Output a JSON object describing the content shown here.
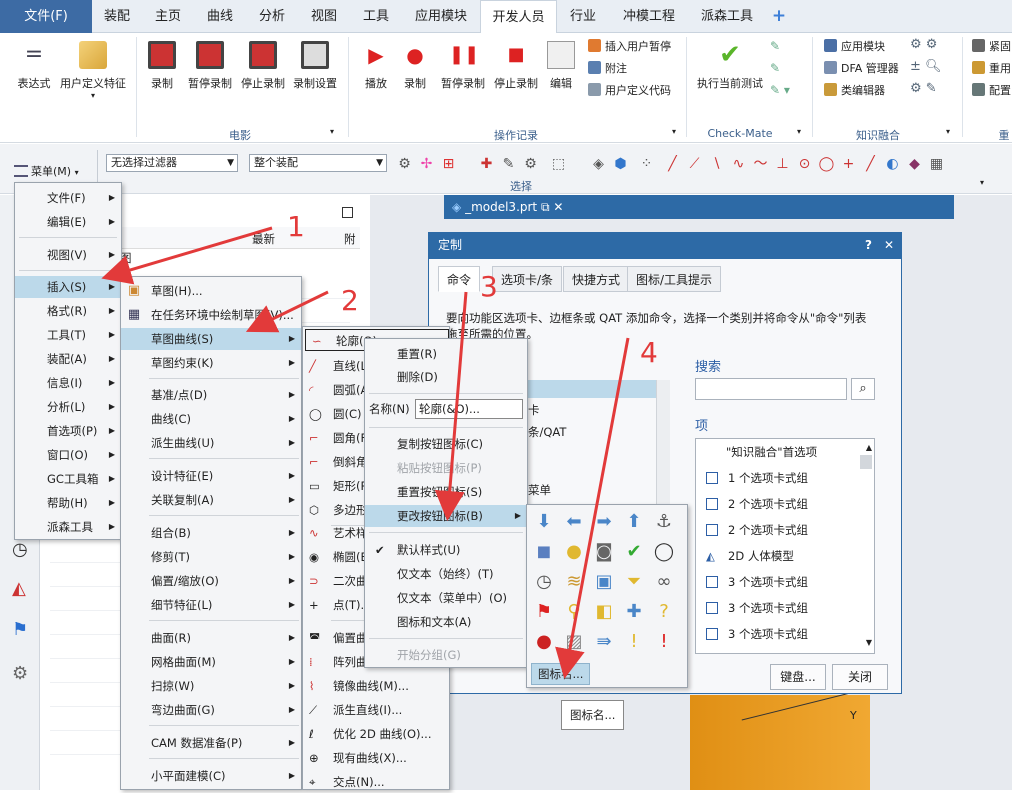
{
  "menubar": {
    "file": "文件(F)",
    "tabs": [
      "装配",
      "主页",
      "曲线",
      "分析",
      "视图",
      "工具",
      "应用模块",
      "开发人员",
      "行业",
      "冲模工程",
      "派森工具"
    ],
    "plus": "+"
  },
  "ribbon": {
    "expr": "表达式",
    "udf": "用户定义特征",
    "record": "录制",
    "pause_record": "暂停录制",
    "stop_record": "停止录制",
    "record_settings": "录制设置",
    "play": "播放",
    "record2": "录制",
    "pause_record2": "暂停录制",
    "stop_record2": "停止录制",
    "edit": "编辑",
    "insert_pause": "插入用户暂停",
    "comment": "附注",
    "user_code": "用户定义代码",
    "run_test": "执行当前测试",
    "app_module": "应用模块",
    "dfa_mgr": "DFA 管理器",
    "class_editor": "类编辑器",
    "tight": "紧固",
    "reuse": "重用",
    "config": "配置",
    "group_movie": "电影",
    "group_ops": "操作记录",
    "group_check": "Check-Mate",
    "group_knowledge": "知识融合",
    "group_more": "重"
  },
  "toolbar": {
    "menu_btn": "菜单(M)",
    "filter": "无选择过滤器",
    "assembly": "整个装配",
    "select_label": "选择"
  },
  "nav": {
    "col_latest": "最新",
    "partial": "图"
  },
  "viewport": {
    "tab_title": "_model3.prt",
    "axis_y": "Y"
  },
  "main_menu": [
    {
      "label": "文件(F)",
      "arrow": true
    },
    {
      "label": "编辑(E)",
      "arrow": true
    },
    {
      "label": "视图(V)",
      "arrow": true
    },
    {
      "label": "插入(S)",
      "arrow": true
    },
    {
      "label": "格式(R)",
      "arrow": true
    },
    {
      "label": "工具(T)",
      "arrow": true
    },
    {
      "label": "装配(A)",
      "arrow": true
    },
    {
      "label": "信息(I)",
      "arrow": true
    },
    {
      "label": "分析(L)",
      "arrow": true
    },
    {
      "label": "首选项(P)",
      "arrow": true
    },
    {
      "label": "窗口(O)",
      "arrow": true
    },
    {
      "label": "GC工具箱",
      "arrow": true
    },
    {
      "label": "帮助(H)",
      "arrow": true
    },
    {
      "label": "派森工具",
      "arrow": true
    }
  ],
  "insert_menu": [
    {
      "label": "草图(H)..."
    },
    {
      "label": "在任务环境中绘制草图(V)..."
    },
    {
      "label": "草图曲线(S)",
      "arrow": true
    },
    {
      "label": "草图约束(K)",
      "arrow": true
    },
    {
      "label": "基准/点(D)",
      "arrow": true
    },
    {
      "label": "曲线(C)",
      "arrow": true
    },
    {
      "label": "派生曲线(U)",
      "arrow": true
    },
    {
      "label": "设计特征(E)",
      "arrow": true
    },
    {
      "label": "关联复制(A)",
      "arrow": true
    },
    {
      "label": "组合(B)",
      "arrow": true
    },
    {
      "label": "修剪(T)",
      "arrow": true
    },
    {
      "label": "偏置/缩放(O)",
      "arrow": true
    },
    {
      "label": "细节特征(L)",
      "arrow": true
    },
    {
      "label": "曲面(R)",
      "arrow": true
    },
    {
      "label": "网格曲面(M)",
      "arrow": true
    },
    {
      "label": "扫掠(W)",
      "arrow": true
    },
    {
      "label": "弯边曲面(G)",
      "arrow": true
    },
    {
      "label": "CAM 数据准备(P)",
      "arrow": true
    },
    {
      "label": "小平面建模(C)",
      "arrow": true
    }
  ],
  "sketch_curve_menu": [
    {
      "label": "轮廓(O)"
    },
    {
      "label": "直线(L)"
    },
    {
      "label": "圆弧(A)"
    },
    {
      "label": "圆(C)"
    },
    {
      "label": "圆角(F)"
    },
    {
      "label": "倒斜角"
    },
    {
      "label": "矩形(R)"
    },
    {
      "label": "多边形"
    },
    {
      "label": "艺术样"
    },
    {
      "label": "椭圆(E)"
    },
    {
      "label": "二次曲"
    },
    {
      "label": "点(T)..."
    },
    {
      "label": "偏置曲"
    },
    {
      "label": "阵列曲"
    },
    {
      "label": "镜像曲线(M)..."
    },
    {
      "label": "派生直线(I)..."
    },
    {
      "label": "优化 2D 曲线(O)..."
    },
    {
      "label": "现有曲线(X)..."
    },
    {
      "label": "交点(N)..."
    }
  ],
  "context_menu": {
    "reset": "重置(R)",
    "delete": "删除(D)",
    "name_label": "名称(N)",
    "name_value": "轮廓(&O)...",
    "copy_icon": "复制按钮图标(C)",
    "paste_icon": "粘贴按钮图标(P)",
    "reset_icon": "重置按钮图标(S)",
    "change_icon": "更改按钮图标(B)",
    "default_style": "默认样式(U)",
    "text_only_always": "仅文本（始终）(T)",
    "text_only_menu": "仅文本（菜单中）(O)",
    "icon_and_text": "图标和文本(A)",
    "start_group": "开始分组(G)"
  },
  "icon_picker": {
    "button": "图标名...",
    "tooltip": "图标名..."
  },
  "dialog": {
    "title": "定制",
    "help": "?",
    "close": "✕",
    "tabs": [
      "命令",
      "选项卡/条",
      "快捷方式",
      "图标/工具提示"
    ],
    "desc_line1": "要向功能区选项卡、边框条或 QAT 添加命令，选择一个类别并将命令从\"命令\"列表",
    "desc_line2": "拖至所需的位置。",
    "category_partial": [
      "卡",
      "条/QAT",
      "菜单"
    ],
    "search_label": "搜索",
    "items_label": "项",
    "items": [
      "\"知识融合\"首选项",
      "1 个选项卡式组",
      "2 个选项卡式组",
      "2 个选项卡式组",
      "2D 人体模型",
      "3 个选项卡式组",
      "3 个选项卡式组",
      "3 个选项卡式组"
    ],
    "keyboard_btn": "键盘...",
    "close_btn": "关闭"
  },
  "annotations": [
    "1",
    "2",
    "3",
    "4"
  ],
  "colors": {
    "file_tab": "#3d6ba4",
    "dialog_title": "#2d6aa6",
    "highlight": "#bcd9ea",
    "arrow_red": "#e23a3a",
    "block_orange": "#e59a1e"
  }
}
